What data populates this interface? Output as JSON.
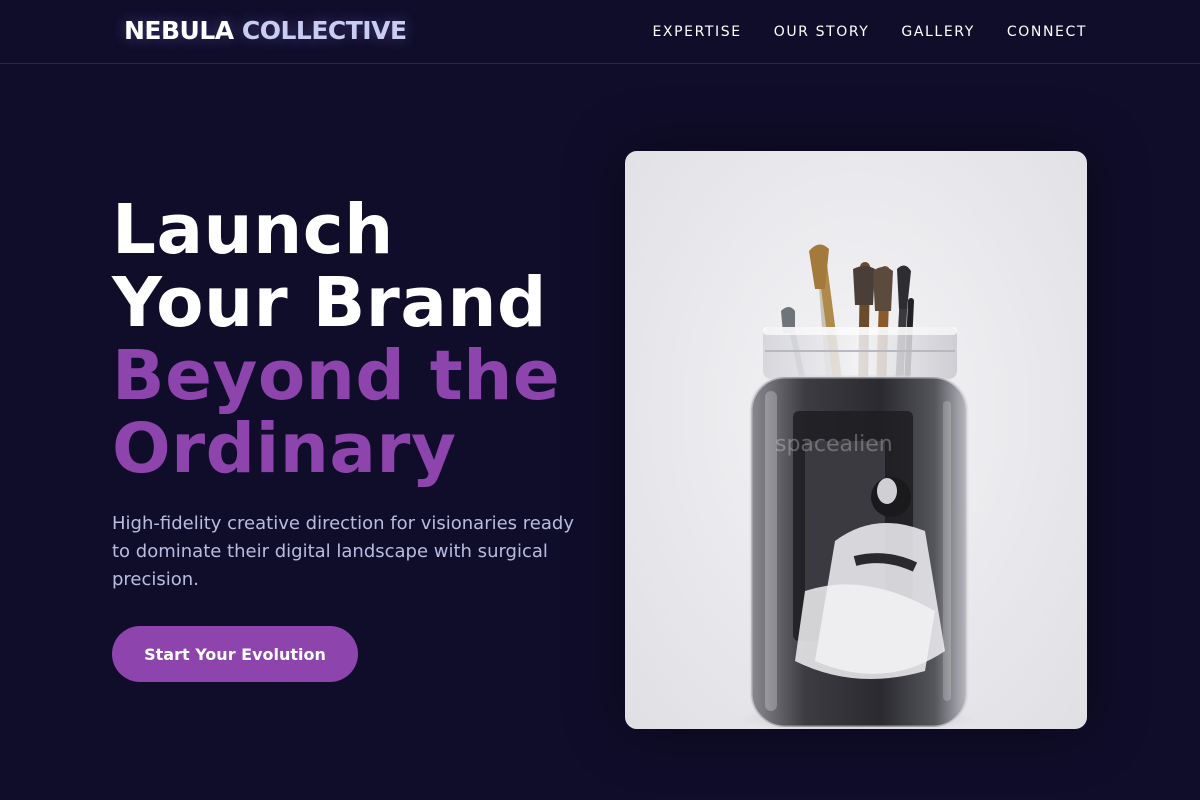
{
  "header": {
    "logo_primary": "NEBULA",
    "logo_secondary": "COLLECTIVE",
    "nav": [
      {
        "label": "EXPERTISE"
      },
      {
        "label": "OUR STORY"
      },
      {
        "label": "GALLERY"
      },
      {
        "label": "CONNECT"
      }
    ]
  },
  "hero": {
    "headline_line1": "Launch",
    "headline_line2": "Your Brand",
    "headline_line3": "Beyond the",
    "headline_line4": "Ordinary",
    "subtitle": "High-fidelity creative direction for visionaries ready to dominate their digital landscape with surgical precision.",
    "cta_label": "Start Your Evolution",
    "image_watermark": "spacealien",
    "image_icon": "jar-of-brushes-photo-icon"
  },
  "colors": {
    "background": "#100d2b",
    "accent": "#8e44ad",
    "logo_secondary": "#c9cdf3",
    "subtitle": "#b8bde0"
  }
}
